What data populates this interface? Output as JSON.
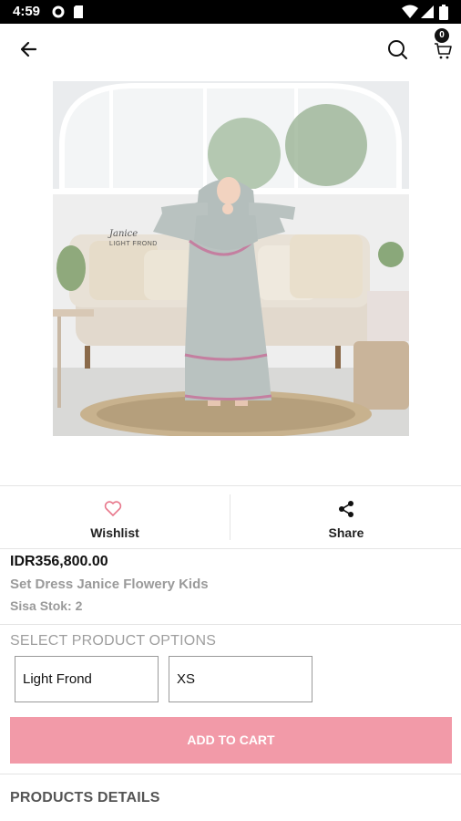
{
  "status_bar": {
    "time": "4:59",
    "left_icons": [
      "gear-icon",
      "sim-card-icon"
    ],
    "right_icons": [
      "wifi-icon",
      "signal-icon",
      "battery-icon"
    ]
  },
  "header": {
    "back_icon": "arrow-left-icon",
    "search_icon": "search-icon",
    "cart_icon": "cart-icon",
    "cart_count": "0"
  },
  "product_image": {
    "caption_line1": "Janice",
    "caption_line2": "LIGHT FROND"
  },
  "actions": {
    "wishlist_label": "Wishlist",
    "wishlist_icon": "heart-icon",
    "share_label": "Share",
    "share_icon": "share-icon"
  },
  "product": {
    "price": "IDR356,800.00",
    "name": "Set Dress Janice Flowery Kids",
    "stock": "Sisa Stok: 2"
  },
  "options": {
    "title": "SELECT PRODUCT OPTIONS",
    "color_value": "Light Frond",
    "size_value": "XS"
  },
  "add_to_cart_label": "ADD TO CART",
  "details_title": "PRODUCTS DETAILS",
  "colors": {
    "accent_pink": "#f29aa8",
    "heart_pink": "#e8788c",
    "dress_gray": "#b9c2c0"
  }
}
